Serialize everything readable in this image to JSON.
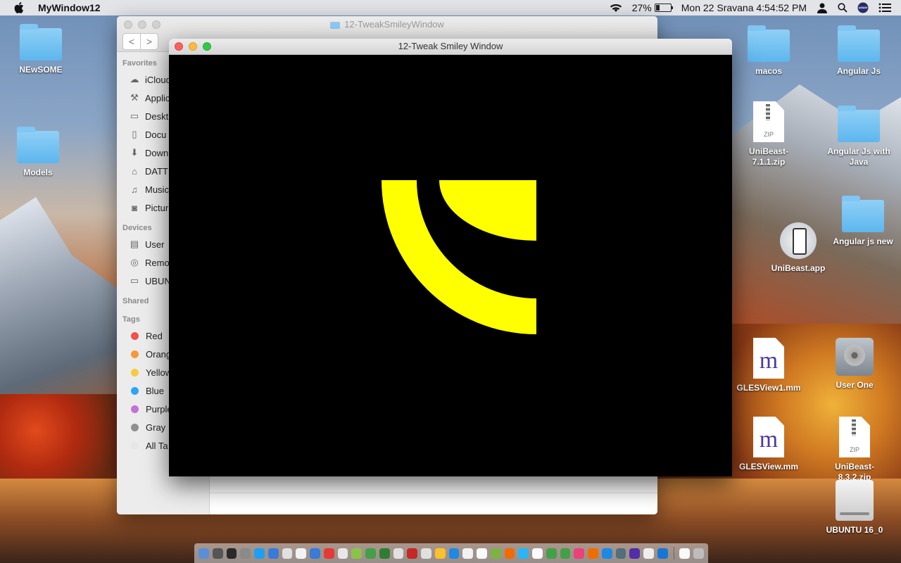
{
  "menubar": {
    "app_name": "MyWindow12",
    "battery": "27%",
    "battery_level": 0.27,
    "clock": "Mon 22 Sravana  4:54:52 PM"
  },
  "desktop_icons": {
    "newsome": "NEwSOME",
    "models": "Models",
    "macos": "macos",
    "angular_js": "Angular Js",
    "unibeast_zip_1": "UniBeast-7.1.1.zip",
    "angular_js_java": "Angular Js with Java",
    "angular_js_new": "Angular js new",
    "unibeast_app": "UniBeast.app",
    "glesview1": "GLESView1.mm",
    "user_one": "User One",
    "glesview": "GLESView.mm",
    "unibeast_zip_2": "UniBeast-8.3.2.zip",
    "ubuntu": "UBUNTU 16_0",
    "zip_label": "ZIP",
    "m_glyph": "m"
  },
  "finder": {
    "title": "12-TweakSmileyWindow",
    "back": "<",
    "forward": ">",
    "sections": {
      "favorites": "Favorites",
      "devices": "Devices",
      "shared": "Shared",
      "tags": "Tags"
    },
    "favorites": [
      "iCloud",
      "Applic",
      "Deskt",
      "Docu",
      "Down",
      "DATT",
      "Music",
      "Pictur"
    ],
    "devices": [
      "User",
      "Remo",
      "UBUN"
    ],
    "tags": [
      {
        "label": "Red",
        "color": "#f2504b"
      },
      {
        "label": "Orang",
        "color": "#f59a3a"
      },
      {
        "label": "Yellow",
        "color": "#f8cb3f"
      },
      {
        "label": "Blue",
        "color": "#2fa4f2"
      },
      {
        "label": "Purple",
        "color": "#c571d6"
      },
      {
        "label": "Gray",
        "color": "#8f8f8f"
      },
      {
        "label": "All Ta",
        "color": "#e6e6e6"
      }
    ]
  },
  "smiley_window": {
    "title": "12-Tweak Smiley Window",
    "fill_color": "#ffff00",
    "background": "#000000"
  },
  "colors": {
    "traffic_red": "#fc605c",
    "traffic_yellow": "#fdbc40",
    "traffic_green": "#34c84a"
  },
  "dock": {
    "app_colors": [
      "#5a8fd8",
      "#555",
      "#2a2a2a",
      "#8a8a8a",
      "#1e9ff2",
      "#3a7ad8",
      "#e0e0e0",
      "#f2f2f2",
      "#3a7ad8",
      "#e53935",
      "#e7e7e7",
      "#8bc34a",
      "#43a047",
      "#2e7d32",
      "#e0e0e0",
      "#c62828",
      "#e0e0e0",
      "#fbc02d",
      "#1e88e5",
      "#f2f2f2",
      "#fafafa",
      "#7cb342",
      "#ef6c00",
      "#29b6f6",
      "#fafafa",
      "#43a047",
      "#43a047",
      "#ec407a",
      "#ef6c00",
      "#1e88e5",
      "#546e7a",
      "#512da8",
      "#eeeeee",
      "#1976d2",
      "#f9f9f9",
      "#bdbdbd"
    ]
  }
}
